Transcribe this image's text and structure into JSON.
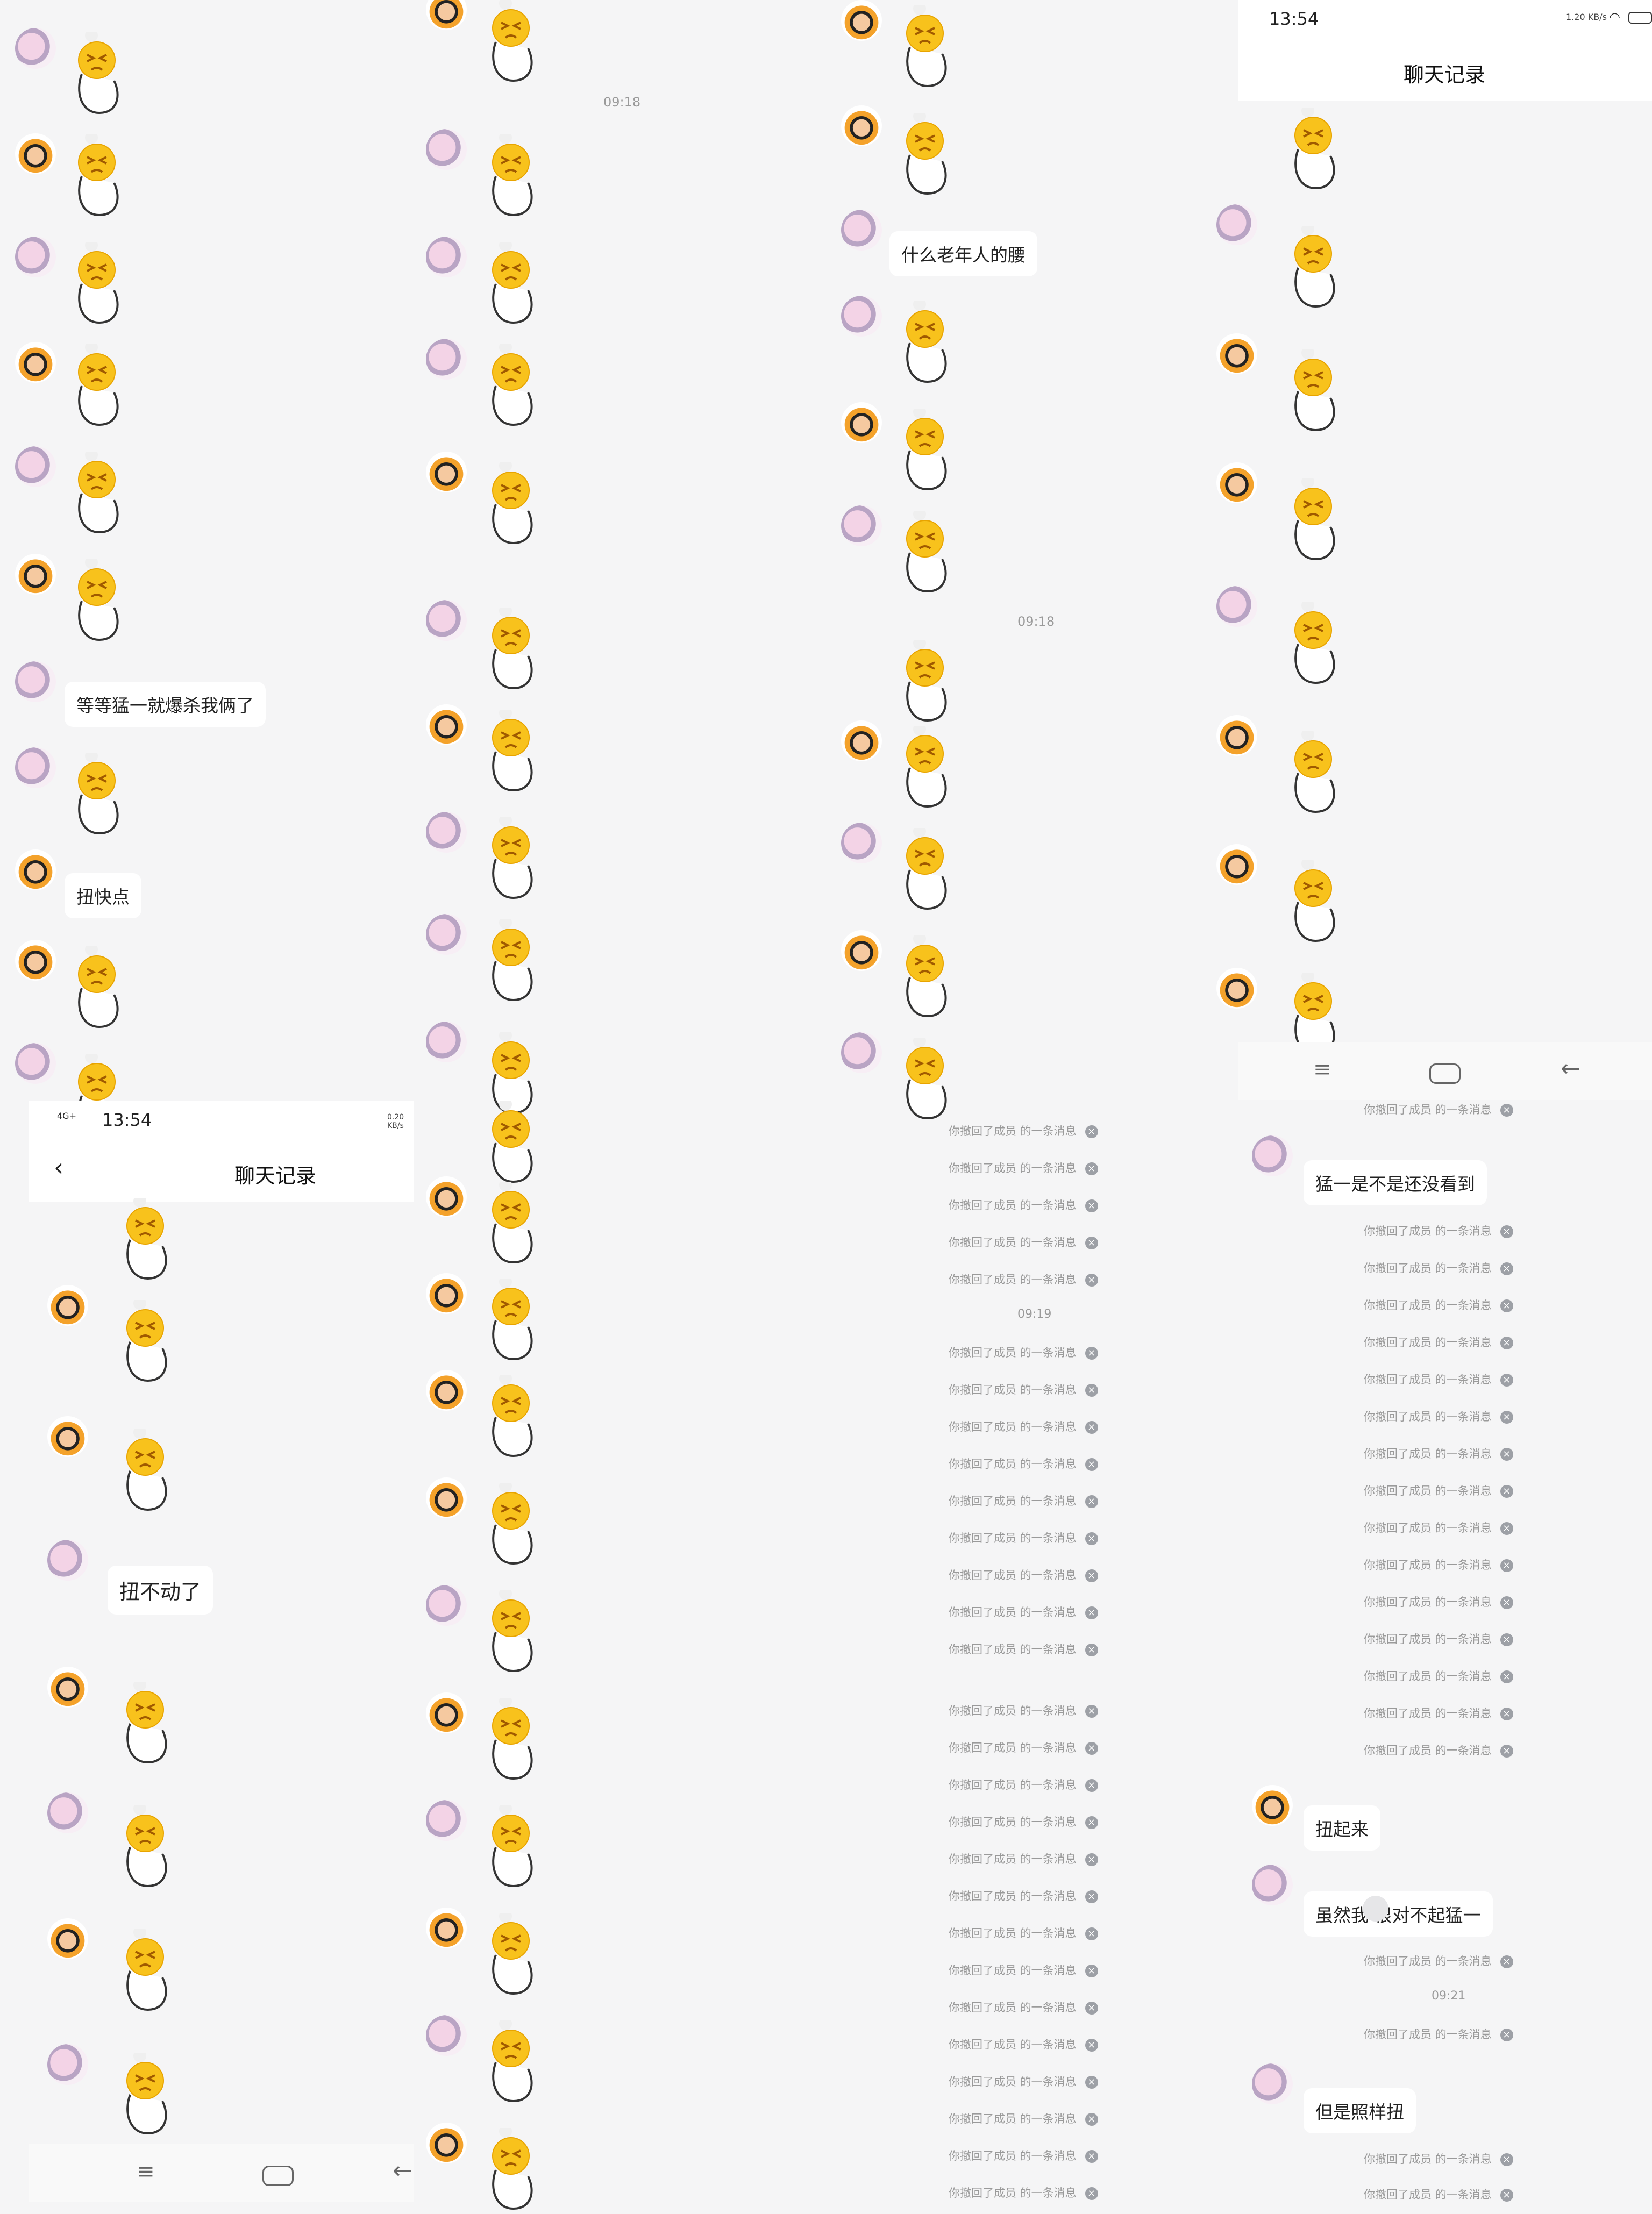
{
  "panels": {
    "top_right": {
      "status_time": "13:54",
      "status_speed": "1.20 KB/s",
      "title": "聊天记录"
    },
    "bottom_left": {
      "status_time": "13:54",
      "status_signal": "4G+",
      "status_speed": "0.20 KB/s",
      "title": "聊天记录"
    }
  },
  "timestamps": [
    "09:18",
    "09:18",
    "09:19",
    "09:21"
  ],
  "messages": [
    "等等猛一就爆杀我俩了",
    "扭快点",
    "什么老年人的腰",
    "扭不动了",
    "猛一是不是还没看到",
    "扭起来",
    "虽然我     很对不起猛一",
    "但是照样扭"
  ],
  "recall_text": "你撤回了成员   的一条消息",
  "icons": {
    "back": "back-arrow-icon",
    "menu": "menu-icon",
    "home": "home-icon",
    "nav_back": "nav-back-icon",
    "recall_close": "close-circle-icon"
  },
  "colors": {
    "background": "#f5f5f6",
    "bubble": "#ffffff",
    "meta_text": "#9a9a9a"
  }
}
